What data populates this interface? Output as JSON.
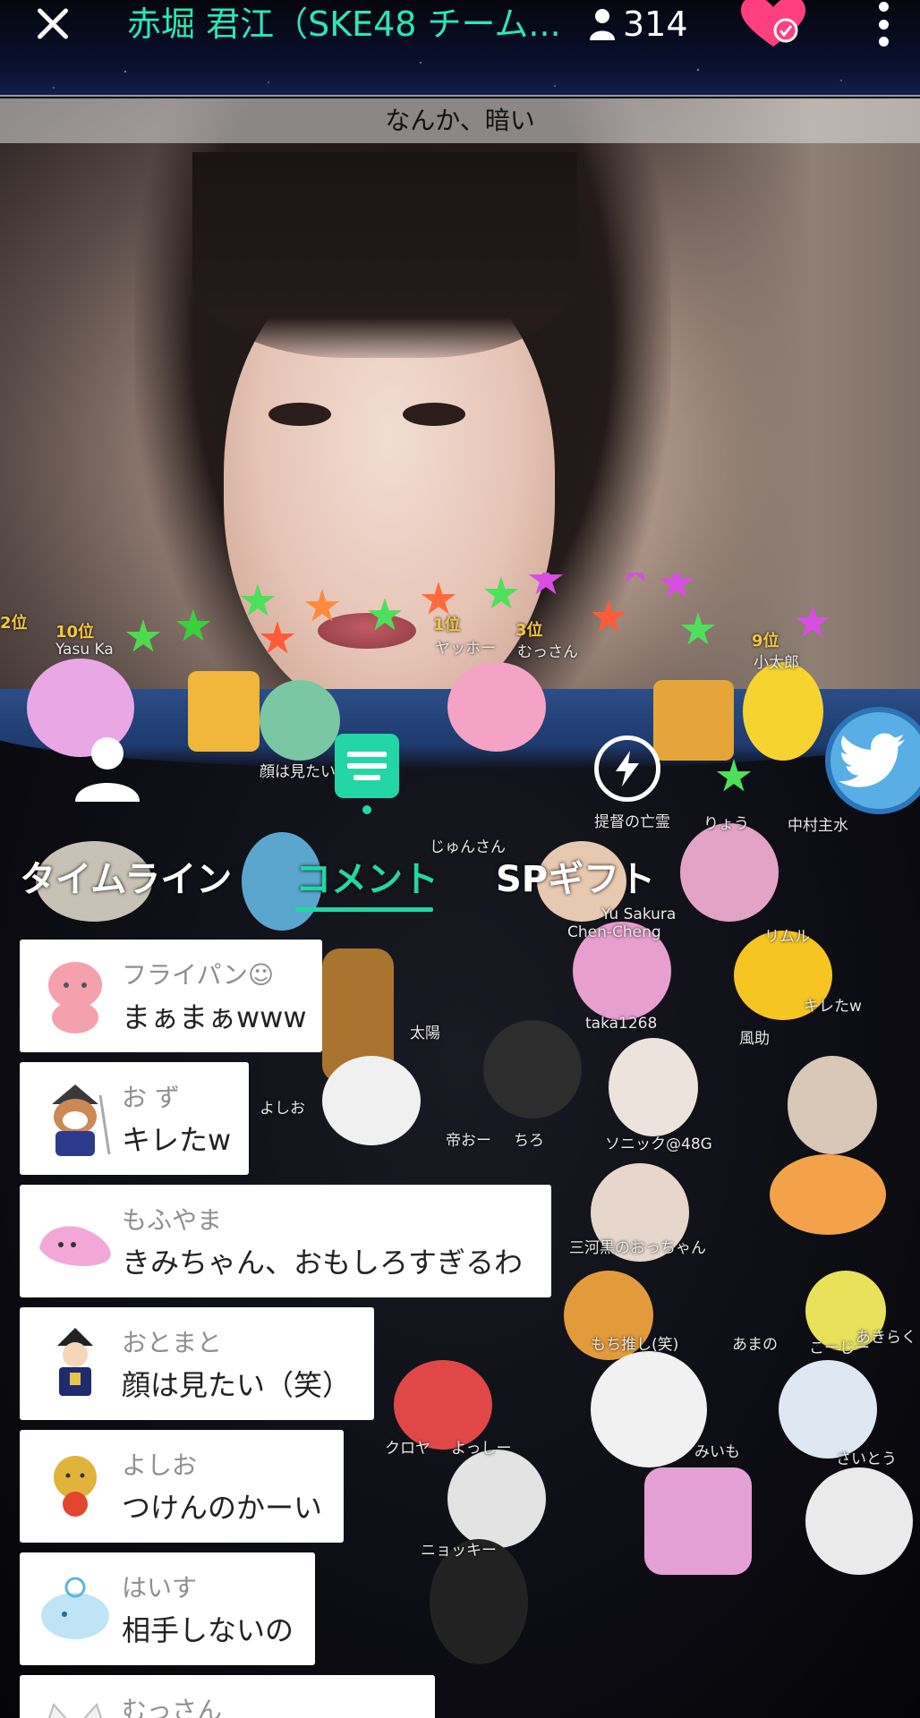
{
  "header": {
    "title": "赤堀 君江（SKE48 チーム...",
    "viewer_count": "314"
  },
  "stream": {
    "caption": "なんか、暗い"
  },
  "collage": {
    "rank_tags": [
      "2位",
      "10位",
      "1位",
      "3位",
      "9位"
    ],
    "name_tags": [
      "Yasu Ka",
      "ヤッホー",
      "むっさん",
      "小太郎",
      "顔は見たい",
      "提督の亡霊",
      "りょう",
      "中村主水",
      "じゅんさん",
      "Chen-Cheng",
      "Yu Sakura",
      "リムル",
      "キレたw",
      "taka1268",
      "風助",
      "太陽",
      "ソニック@48G",
      "ニョッキー",
      "三河黒のおっちゃん",
      "もち推し(笑)",
      "あまの",
      "こーじー",
      "あきらく",
      "クロヤ",
      "よっしー",
      "みいも",
      "さいとう",
      "よしお",
      "ちろ",
      "帝おー"
    ]
  },
  "tabs": [
    {
      "label": "タイムライン",
      "active": false
    },
    {
      "label": "コメント",
      "active": true
    },
    {
      "label": "SPギフト",
      "active": false
    }
  ],
  "comments": [
    {
      "user": "フライパン☺",
      "text": "まぁまぁwww",
      "avatar": "pink-character-icon"
    },
    {
      "user": "お ず",
      "text": "キレたw",
      "avatar": "samurai-raccoon-icon"
    },
    {
      "user": "もふやま",
      "text": "きみちゃん、おもしろすぎるわ",
      "avatar": "pink-blob-icon"
    },
    {
      "user": "おとまと",
      "text": "顔は見たい（笑）",
      "avatar": "shogun-figure-icon"
    },
    {
      "user": "よしお",
      "text": "つけんのかーい",
      "avatar": "sun-face-icon"
    },
    {
      "user": "はいす",
      "text": "相手しないの",
      "avatar": "blue-whale-icon"
    },
    {
      "user": "むっさん",
      "text": "",
      "avatar": "cat-icon"
    }
  ],
  "colors": {
    "accent": "#22d7a5",
    "title": "#2ee6b4",
    "twitter": "#5aaee6",
    "heart": "#ff3f7f"
  }
}
